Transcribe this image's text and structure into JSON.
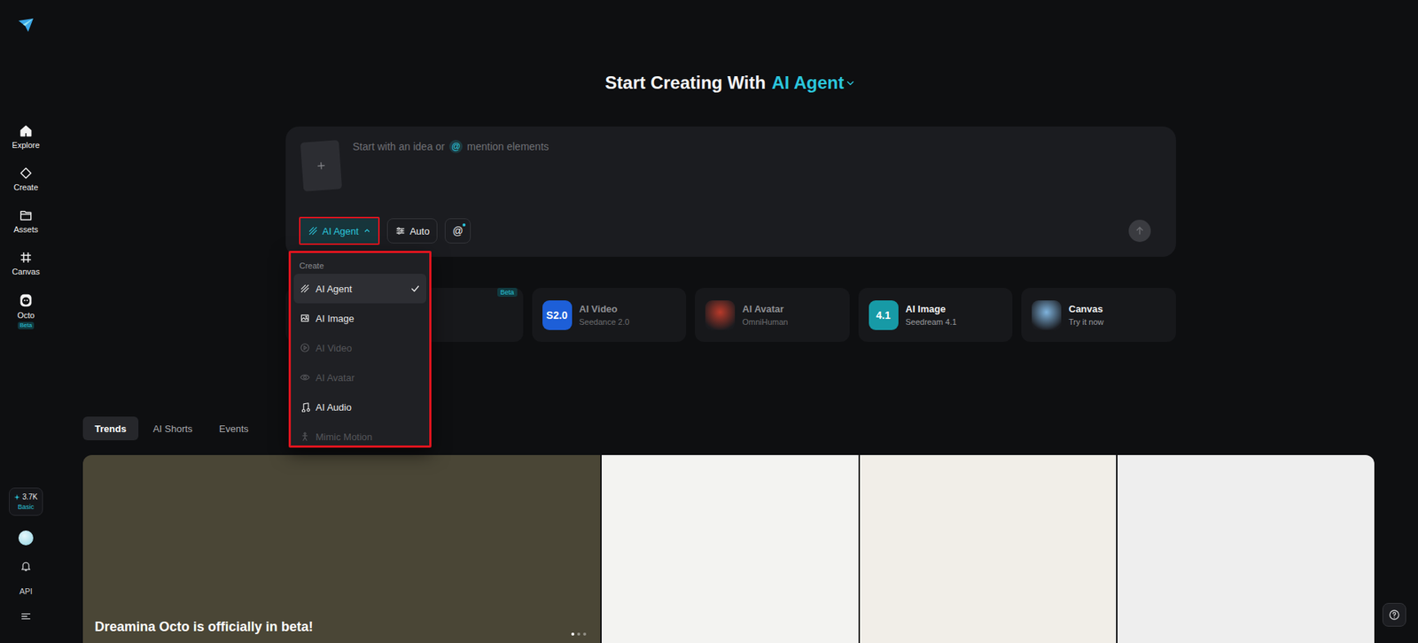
{
  "sidebar": {
    "items": [
      {
        "label": "Explore",
        "selected": false
      },
      {
        "label": "Create",
        "selected": false
      },
      {
        "label": "Assets",
        "selected": false
      },
      {
        "label": "Canvas",
        "selected": false
      },
      {
        "label": "Octo",
        "selected": false,
        "badge": "Beta"
      }
    ],
    "credits": {
      "amount": "3.7K",
      "plan": "Basic"
    },
    "api": "API"
  },
  "hero": {
    "prefix": "Start Creating With",
    "mode": "AI Agent"
  },
  "prompt": {
    "placeholder_start": "Start with an idea or",
    "mention": "@",
    "placeholder_end": "mention elements",
    "mode_button": {
      "label": "AI Agent",
      "expanded": true,
      "highlighted": true
    },
    "settings_button": {
      "label": "Auto"
    },
    "mention_button": {
      "label": "@"
    },
    "send_button": {
      "disabled": true
    }
  },
  "mode_menu": {
    "header": "Create",
    "highlighted": true,
    "items": [
      {
        "label": "AI Agent",
        "selected": true,
        "disabled": false
      },
      {
        "label": "AI Image",
        "selected": false,
        "disabled": false
      },
      {
        "label": "AI Video",
        "selected": false,
        "disabled": true
      },
      {
        "label": "AI Avatar",
        "selected": false,
        "disabled": true
      },
      {
        "label": "AI Audio",
        "selected": false,
        "disabled": false
      },
      {
        "label": "Mimic Motion",
        "selected": false,
        "disabled": true
      }
    ]
  },
  "shortcuts": {
    "featured_badge": "Beta",
    "cards": [
      {
        "title": "AI Video",
        "subtitle": "Seedance 2.0",
        "kind": "logo",
        "icon_text": "S2.0",
        "color": "#1d5fd8",
        "disabled": true
      },
      {
        "title": "AI Avatar",
        "subtitle": "OmniHuman",
        "kind": "picture",
        "color": "#b83a2a",
        "disabled": true
      },
      {
        "title": "AI Image",
        "subtitle": "Seedream 4.1",
        "kind": "logo",
        "icon_text": "4.1",
        "color": "#179aa6",
        "disabled": false
      },
      {
        "title": "Canvas",
        "subtitle": "Try it now",
        "kind": "picture",
        "color": "#7fb3dd",
        "disabled": false
      }
    ]
  },
  "feed_tabs": [
    {
      "label": "Trends",
      "selected": true
    },
    {
      "label": "AI Shorts",
      "selected": false
    },
    {
      "label": "Events",
      "selected": false
    }
  ],
  "gallery": {
    "tiles": [
      {
        "caption": "Dreamina Octo is officially in beta!",
        "color": "#4a4636"
      },
      {
        "color": "#f3f3f1"
      },
      {
        "color": "#f1eee8"
      },
      {
        "color": "#eeeeee"
      }
    ],
    "dots": [
      {
        "selected": true
      },
      {
        "selected": false
      },
      {
        "selected": false
      }
    ]
  }
}
